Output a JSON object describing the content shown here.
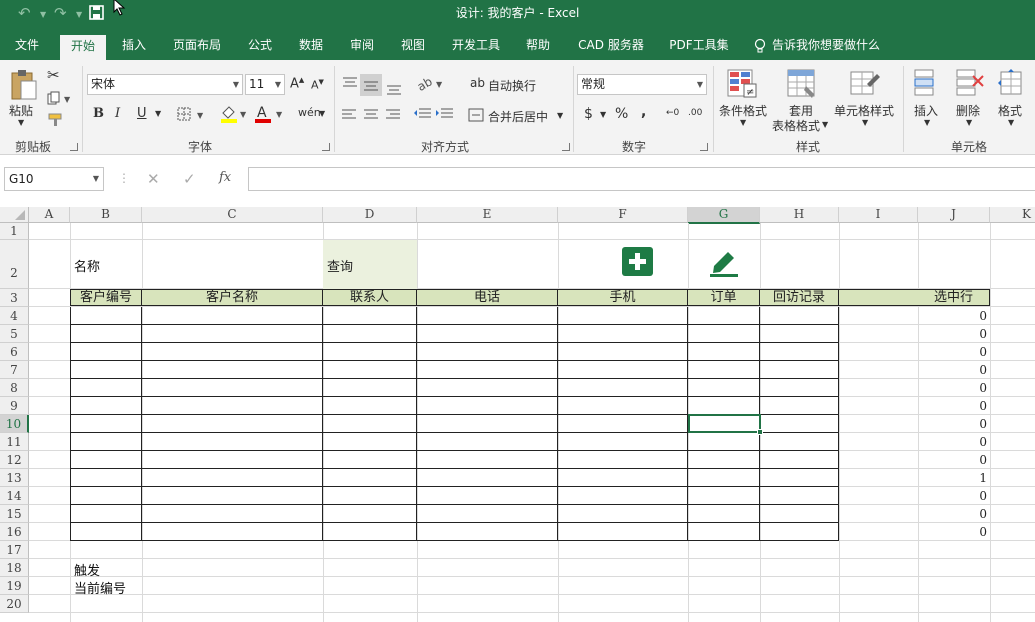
{
  "titlebar": {
    "title": "设计: 我的客户  -  Excel",
    "undo_icon": "↶",
    "redo_icon": "↷",
    "save_icon": "save-icon"
  },
  "tabs": [
    "文件",
    "开始",
    "插入",
    "页面布局",
    "公式",
    "数据",
    "审阅",
    "视图",
    "开发工具",
    "帮助",
    "CAD 服务器",
    "PDF工具集"
  ],
  "active_tab": "开始",
  "tell_me": "告诉我你想要做什么",
  "ribbon": {
    "clipboard": {
      "paste": "粘贴",
      "label": "剪贴板"
    },
    "font": {
      "name": "宋体",
      "size": "11",
      "bold": "B",
      "italic": "I",
      "underline": "U",
      "label": "字体",
      "wen": "wén"
    },
    "alignment": {
      "wrap": "自动换行",
      "merge": "合并后居中",
      "label": "对齐方式"
    },
    "number": {
      "format": "常规",
      "currency": "$",
      "percent": "%",
      "comma": ",",
      "label": "数字"
    },
    "styles": {
      "conditional": "条件格式",
      "table_l1": "套用",
      "table_l2": "表格格式",
      "cell_style": "单元格样式",
      "label": "样式"
    },
    "cells": {
      "insert": "插入",
      "delete": "删除",
      "format": "格式",
      "label": "单元格"
    }
  },
  "formula_bar": {
    "name_box": "G10",
    "fx": "fx",
    "cancel": "✕",
    "enter": "✓",
    "formula": ""
  },
  "columns": [
    "A",
    "B",
    "C",
    "D",
    "E",
    "F",
    "G",
    "H",
    "I",
    "J",
    "K"
  ],
  "rows": [
    "1",
    "2",
    "3",
    "4",
    "5",
    "6",
    "7",
    "8",
    "9",
    "10",
    "11",
    "12",
    "13",
    "14",
    "15",
    "16",
    "17",
    "18",
    "19",
    "20"
  ],
  "selected_cell": {
    "col": "G",
    "row": "10"
  },
  "sheet": {
    "label_name": "名称",
    "search_btn": "查询",
    "header": [
      "客户编号",
      "客户名称",
      "联系人",
      "电话",
      "手机",
      "订单",
      "回访记录"
    ],
    "selected_row_header": "选中行",
    "selected_values": [
      "0",
      "0",
      "0",
      "0",
      "0",
      "0",
      "0",
      "0",
      "0",
      "1",
      "0",
      "0",
      "0"
    ],
    "trigger_label": "触发",
    "current_id_label": "当前编号"
  },
  "colors": {
    "excel_green": "#217346",
    "header_fill": "#d8e4bc",
    "query_fill": "#ebf1de",
    "add_button": "#1e7b45",
    "edit_button": "#1e7b45"
  }
}
